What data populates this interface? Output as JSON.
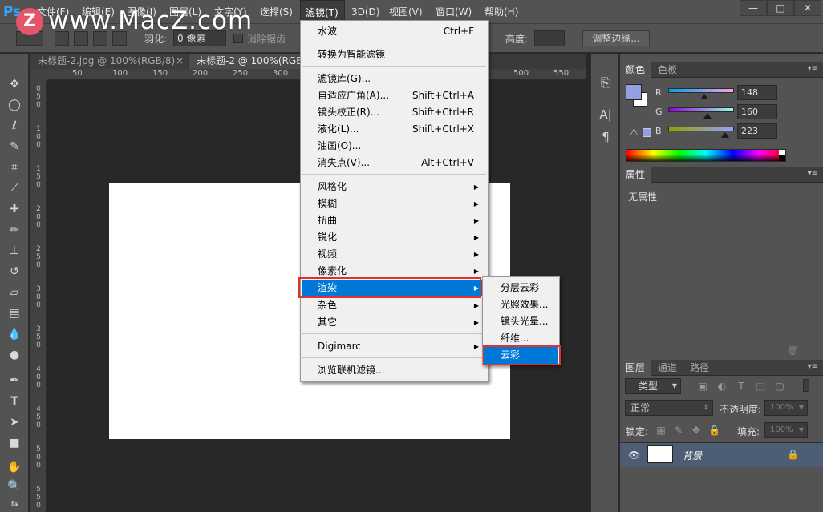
{
  "app": {
    "logo": "Ps"
  },
  "watermark": {
    "badge": "Z",
    "text": "www.MacZ.com"
  },
  "menubar": {
    "items": [
      "文件(F)",
      "编辑(E)",
      "图像(I)",
      "图层(L)",
      "文字(Y)",
      "选择(S)",
      "滤镜(T)",
      "3D(D)",
      "视图(V)",
      "窗口(W)",
      "帮助(H)"
    ],
    "window_buttons": {
      "minimize": "—",
      "restore": "□",
      "close": "✕"
    }
  },
  "options": {
    "feather_label": "羽化:",
    "feather_value": "0 像素",
    "antialias_label": "消除锯齿",
    "height_label": "高度:",
    "refine_edge": "调整边缘..."
  },
  "tabs": [
    {
      "label": "未标题-2.jpg @ 100%(RGB/8)",
      "close": "×"
    },
    {
      "label": "未标题-2 @ 100%(RGB/"
    }
  ],
  "ruler": {
    "top": [
      "50",
      "100",
      "150",
      "200",
      "250",
      "300",
      "350",
      "400",
      "450",
      "500",
      "550"
    ],
    "left": [
      "0",
      "5",
      "0",
      "1",
      "0",
      "0",
      "1",
      "5",
      "0",
      "2",
      "0",
      "0",
      "2",
      "5",
      "0",
      "3",
      "0",
      "0",
      "3",
      "5",
      "0",
      "4",
      "0",
      "0",
      "4",
      "5",
      "0",
      "5",
      "0",
      "0",
      "5",
      "5",
      "0"
    ]
  },
  "filter_menu": {
    "items": [
      {
        "label": "水波",
        "shortcut": "Ctrl+F"
      },
      {
        "label": "转换为智能滤镜"
      },
      {
        "label": "滤镜库(G)..."
      },
      {
        "label": "自适应广角(A)...",
        "shortcut": "Shift+Ctrl+A"
      },
      {
        "label": "镜头校正(R)...",
        "shortcut": "Shift+Ctrl+R"
      },
      {
        "label": "液化(L)...",
        "shortcut": "Shift+Ctrl+X"
      },
      {
        "label": "油画(O)..."
      },
      {
        "label": "消失点(V)...",
        "shortcut": "Alt+Ctrl+V"
      },
      {
        "label": "风格化",
        "arrow": "▶"
      },
      {
        "label": "模糊",
        "arrow": "▶"
      },
      {
        "label": "扭曲",
        "arrow": "▶"
      },
      {
        "label": "锐化",
        "arrow": "▶"
      },
      {
        "label": "视频",
        "arrow": "▶"
      },
      {
        "label": "像素化",
        "arrow": "▶"
      },
      {
        "label": "渲染",
        "arrow": "▶"
      },
      {
        "label": "杂色",
        "arrow": "▶"
      },
      {
        "label": "其它",
        "arrow": "▶"
      },
      {
        "label": "Digimarc",
        "arrow": "▶"
      },
      {
        "label": "浏览联机滤镜..."
      }
    ]
  },
  "render_submenu": {
    "items": [
      "分层云彩",
      "光照效果...",
      "镜头光晕...",
      "纤维...",
      "云彩"
    ]
  },
  "panels": {
    "color": {
      "tabs": [
        "颜色",
        "色板"
      ],
      "menu": "▾≡",
      "channels": [
        {
          "letter": "R",
          "value": "148",
          "fraction": 0.58
        },
        {
          "letter": "G",
          "value": "160",
          "fraction": 0.63
        },
        {
          "letter": "B",
          "value": "223",
          "fraction": 0.87
        }
      ],
      "foreground": "#94a0df",
      "background": "#ffffff"
    },
    "properties": {
      "tab": "属性",
      "menu": "▾≡",
      "empty": "无属性"
    },
    "layers": {
      "tabs": [
        "图层",
        "通道",
        "路径"
      ],
      "menu": "▾≡",
      "kind_filter": "类型",
      "blend_mode": "正常",
      "opacity_label": "不透明度:",
      "opacity_value": "100%",
      "lock_label": "锁定:",
      "fill_label": "填充:",
      "fill_value": "100%",
      "layer_name": "背景"
    }
  },
  "colors": {
    "ui_dark": "#535353",
    "canvas_bg": "#282828",
    "menu_highlight": "#0078d7",
    "annotation_red": "#e03131"
  }
}
